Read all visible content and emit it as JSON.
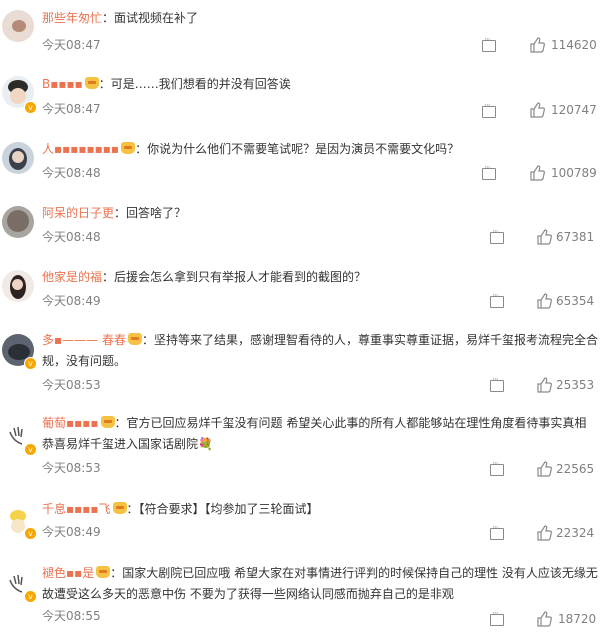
{
  "comments": [
    {
      "name": "那些年匆忙",
      "text": "：面试视频在补了",
      "time": "今天08:47",
      "likes": "114620"
    },
    {
      "name": "B▪▪▪▪",
      "text": "：可是……我们想看的并没有回答诶",
      "time": "今天08:47",
      "likes": "120747"
    },
    {
      "name": "人▪▪▪▪▪▪▪▪",
      "text": "：你说为什么他们不需要笔试呢？是因为演员不需要文化吗？",
      "time": "今天08:48",
      "likes": "100789"
    },
    {
      "name": "阿呆的日子更",
      "text": "：回答啥了？",
      "time": "今天08:48",
      "likes": "67381"
    },
    {
      "name": "他家是的福",
      "text": "：后援会怎么拿到只有举报人才能看到的截图的？",
      "time": "今天08:49",
      "likes": "65354"
    },
    {
      "name": "多▪——— 春春",
      "text": "：坚持等来了结果，感谢理智看待的人，尊重事实尊重证据，易烊千玺报考流程完全合规，没有问题。",
      "time": "今天08:53",
      "likes": "25353"
    },
    {
      "name": "葡萄▪▪▪▪",
      "text": "：官方已回应易烊千玺没有问题 希望关心此事的所有人都能够站在理性角度看待事实真相 恭喜易烊千玺进入国家话剧院💐",
      "time": "今天08:53",
      "likes": "22565"
    },
    {
      "name": "千息▪▪▪▪飞",
      "text": "：【符合要求】【均参加了三轮面试】",
      "time": "今天08:49",
      "likes": "22324"
    },
    {
      "name": "褪色▪▪是",
      "text": "：国家大剧院已回应哦 希望大家在对事情进行评判的时候保持自己的理性 没有人应该无缘无故遭受这么多天的恶意中伤 不要为了获得一些网络认同感而抛弃自己的是非观",
      "time": "今天08:55",
      "likes": "18720"
    }
  ]
}
